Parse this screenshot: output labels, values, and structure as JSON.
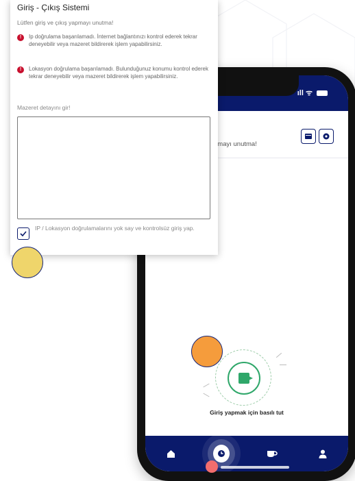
{
  "dialog": {
    "title": "Giriş - Çıkış Sistemi",
    "subtitle": "Lütfen giriş ve çıkış yapmayı unutma!",
    "errors": [
      "Ip doğrulama başarılamadı. İnternet bağlantınızı kontrol ederek tekrar deneyebilir veya mazeret bildirerek işlem yapabilirsiniz.",
      "Lokasyon doğrulama başarılamadı. Bulunduğunuz konumu kontrol ederek tekrar deneyebilir veya mazeret bildirerek işlem yapabilirsiniz."
    ],
    "excuse_label": "Mazeret detayını gir!",
    "excuse_value": "",
    "bypass_label": "IP / Lokasyon doğrulamalarını yok say ve kontrolsüz giriş yap.",
    "bypass_checked": true
  },
  "phone": {
    "status_icons": "ıll ᯤ",
    "header_title_fragment": "ı",
    "header_subtitle_fragment": "pmayı unutma!",
    "hold_label": "Giriş yapmak için basılı tut",
    "nav": [
      "home-icon",
      "clock-icon",
      "coffee-icon",
      "user-icon"
    ]
  },
  "colors": {
    "brand_navy": "#0a1a6b",
    "checkin_green": "#2fa76a",
    "error_red": "#c8102e",
    "marker_yellow": "#efd56b",
    "marker_orange": "#f59c3c",
    "marker_red": "#f26d6d"
  }
}
